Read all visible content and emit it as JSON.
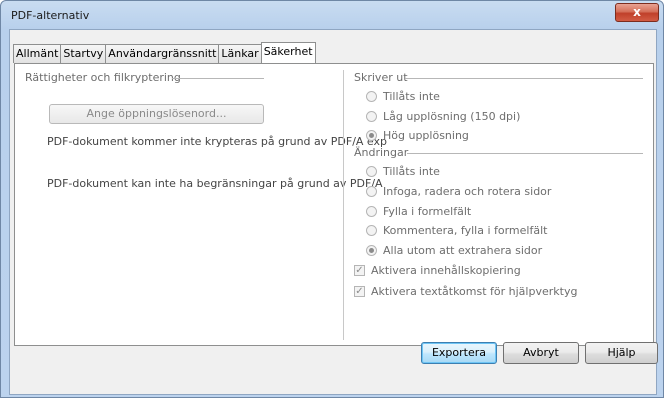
{
  "window": {
    "title": "PDF-alternativ",
    "close_glyph": "x"
  },
  "tabs": [
    {
      "label": "Allmänt",
      "active": false
    },
    {
      "label": "Startvy",
      "active": false
    },
    {
      "label": "Användargränssnitt",
      "active": false
    },
    {
      "label": "Länkar",
      "active": false
    },
    {
      "label": "Säkerhet",
      "active": true
    }
  ],
  "left": {
    "group_title": "Rättigheter och filkryptering",
    "password_button": "Ange öppningslösenord...",
    "info_encrypt": "PDF-dokument kommer inte krypteras på grund av PDF/A exp",
    "info_restrict": "PDF-dokument kan inte ha begränsningar på grund av PDF/A"
  },
  "print": {
    "group_title": "Skriver ut",
    "options": [
      {
        "label": "Tillåts inte",
        "selected": false
      },
      {
        "label": "Låg upplösning (150 dpi)",
        "selected": false
      },
      {
        "label": "Hög upplösning",
        "selected": true
      }
    ]
  },
  "changes": {
    "group_title": "Ändringar",
    "options": [
      {
        "label": "Tillåts inte",
        "selected": false
      },
      {
        "label": "Infoga, radera och rotera sidor",
        "selected": false
      },
      {
        "label": "Fylla i formelfält",
        "selected": false
      },
      {
        "label": "Kommentera, fylla i formelfält",
        "selected": false
      },
      {
        "label": "Alla utom att extrahera sidor",
        "selected": true
      }
    ]
  },
  "checkboxes": [
    {
      "label": "Aktivera innehållskopiering",
      "checked": true
    },
    {
      "label": "Aktivera textåtkomst för hjälpverktyg",
      "checked": true
    }
  ],
  "buttons": {
    "export": "Exportera",
    "cancel": "Avbryt",
    "help": "Hjälp"
  },
  "colors": {
    "title_gradient": "#bcd3ee",
    "close": "#c0402a",
    "default_button": "#bee6fd"
  },
  "icons": {
    "radio_on": "radio-selected-icon",
    "check": "checkmark-icon"
  }
}
